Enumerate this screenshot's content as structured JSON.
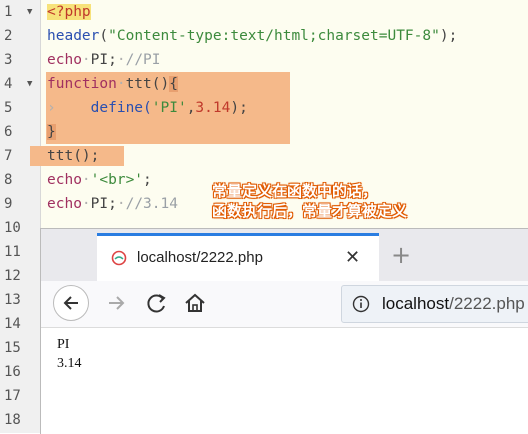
{
  "editor": {
    "line_numbers": [
      "1",
      "2",
      "3",
      "4",
      "5",
      "6",
      "7",
      "8",
      "9",
      "10",
      "11",
      "12",
      "13",
      "14",
      "15",
      "16",
      "17",
      "18"
    ],
    "lines": {
      "l1": "<?php",
      "l2_fn": "header",
      "l2_p1": "(",
      "l2_str": "\"Content-type:text/html;charset=UTF-8\"",
      "l2_p2": ");",
      "l3_kw": "echo",
      "l3_dot": "·",
      "l3_id": "PI;",
      "l3_dot2": "·",
      "l3_cm": "//PI",
      "l4_kw": "function",
      "l4_dot": "·",
      "l4_id": "ttt()",
      "l4_brace": "{",
      "l5_tab": "›",
      "l5_fn": "define(",
      "l5_str": "'PI'",
      "l5_comma": ",",
      "l5_num": "3.14",
      "l5_end": ");",
      "l6": "}",
      "l7": "ttt();",
      "l8_kw": "echo",
      "l8_dot": "·",
      "l8_str": "'<br>'",
      "l8_end": ";",
      "l9_kw": "echo",
      "l9_dot": "·",
      "l9_id": "PI;",
      "l9_dot2": "·",
      "l9_cm": "//3.14"
    }
  },
  "annotation": {
    "line1": "常量定义在函数中的话，",
    "line2": "函数执行后，常量才算被定义"
  },
  "browser": {
    "tab_title": "localhost/2222.php",
    "url_host": "localhost",
    "url_path": "/2222.php",
    "output": [
      "PI",
      "3.14"
    ]
  },
  "colors": {
    "highlight": "#f5b98a",
    "tab_accent": "#2a7de1"
  }
}
